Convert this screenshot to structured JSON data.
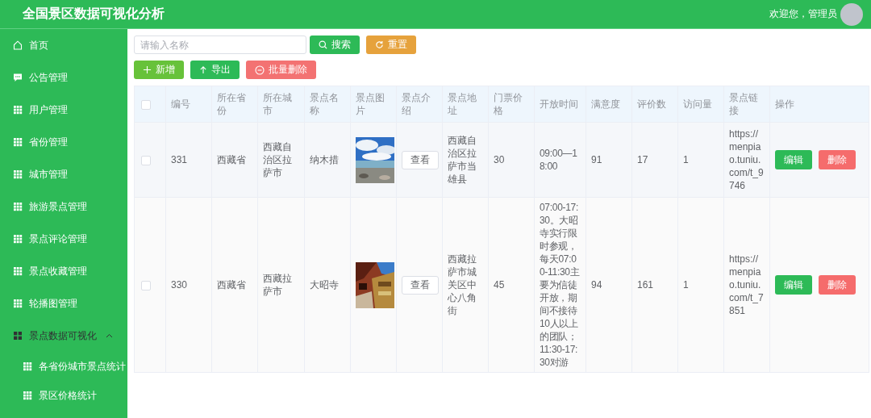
{
  "header": {
    "title": "全国景区数据可视化分析",
    "welcome": "欢迎您，管理员"
  },
  "sidebar": {
    "items": [
      {
        "label": "首页",
        "kind": "home",
        "selected": false
      },
      {
        "label": "公告管理",
        "kind": "notice",
        "selected": false
      },
      {
        "label": "用户管理",
        "kind": "menu",
        "selected": false
      },
      {
        "label": "省份管理",
        "kind": "menu",
        "selected": false
      },
      {
        "label": "城市管理",
        "kind": "menu",
        "selected": false
      },
      {
        "label": "旅游景点管理",
        "kind": "menu",
        "selected": false
      },
      {
        "label": "景点评论管理",
        "kind": "menu",
        "selected": false
      },
      {
        "label": "景点收藏管理",
        "kind": "menu",
        "selected": false
      },
      {
        "label": "轮播图管理",
        "kind": "menu",
        "selected": false
      },
      {
        "label": "景点数据可视化",
        "kind": "group",
        "selected": true,
        "expanded": true,
        "children": [
          {
            "label": "各省份城市景点统计",
            "kind": "menu",
            "selected": false
          },
          {
            "label": "景区价格统计",
            "kind": "menu",
            "selected": false
          }
        ]
      }
    ]
  },
  "toolbar": {
    "search": {
      "placeholder": "请输入名称"
    },
    "buttons": [
      {
        "label": "搜索",
        "kind": "search"
      },
      {
        "label": "重置",
        "kind": "reset"
      },
      {
        "label": "新增",
        "kind": "add"
      },
      {
        "label": "导出",
        "kind": "export"
      },
      {
        "label": "批量删除",
        "kind": "batch-delete"
      }
    ]
  },
  "table": {
    "header_checked": false,
    "columns": [
      "编号",
      "所在省份",
      "所在城市",
      "景点名称",
      "景点图片",
      "景点介绍",
      "景点地址",
      "门票价格",
      "开放时间",
      "满意度",
      "评价数",
      "访问量",
      "景点链接",
      "操作"
    ],
    "rows": [
      {
        "checked": false,
        "id": "331",
        "province": "西藏省",
        "city": "西藏自治区拉萨市",
        "name": "纳木措",
        "intro_button": "查看",
        "address": "西藏自治区拉萨市当雄县",
        "price": "30",
        "open_time": "09:00—18:00",
        "satisfaction": "91",
        "reviews": "17",
        "visits": "1",
        "link": "https://menpiao.tuniu.com/t_9746",
        "actions": [
          {
            "label": "编辑",
            "kind": "edit"
          },
          {
            "label": "删除",
            "kind": "delete"
          }
        ]
      },
      {
        "checked": false,
        "id": "330",
        "province": "西藏省",
        "city": "西藏拉萨市",
        "name": "大昭寺",
        "intro_button": "查看",
        "address": "西藏拉萨市城关区中心八角街",
        "price": "45",
        "open_time": "07:00-17:30。大昭寺实行限时参观，每天07:00-11:30主要为信徒开放，期间不接待10人以上的团队；11:30-17:30对游",
        "satisfaction": "94",
        "reviews": "161",
        "visits": "1",
        "link": "https://menpiao.tuniu.com/t_7851",
        "actions": [
          {
            "label": "编辑",
            "kind": "edit"
          },
          {
            "label": "删除",
            "kind": "delete"
          }
        ]
      }
    ]
  }
}
